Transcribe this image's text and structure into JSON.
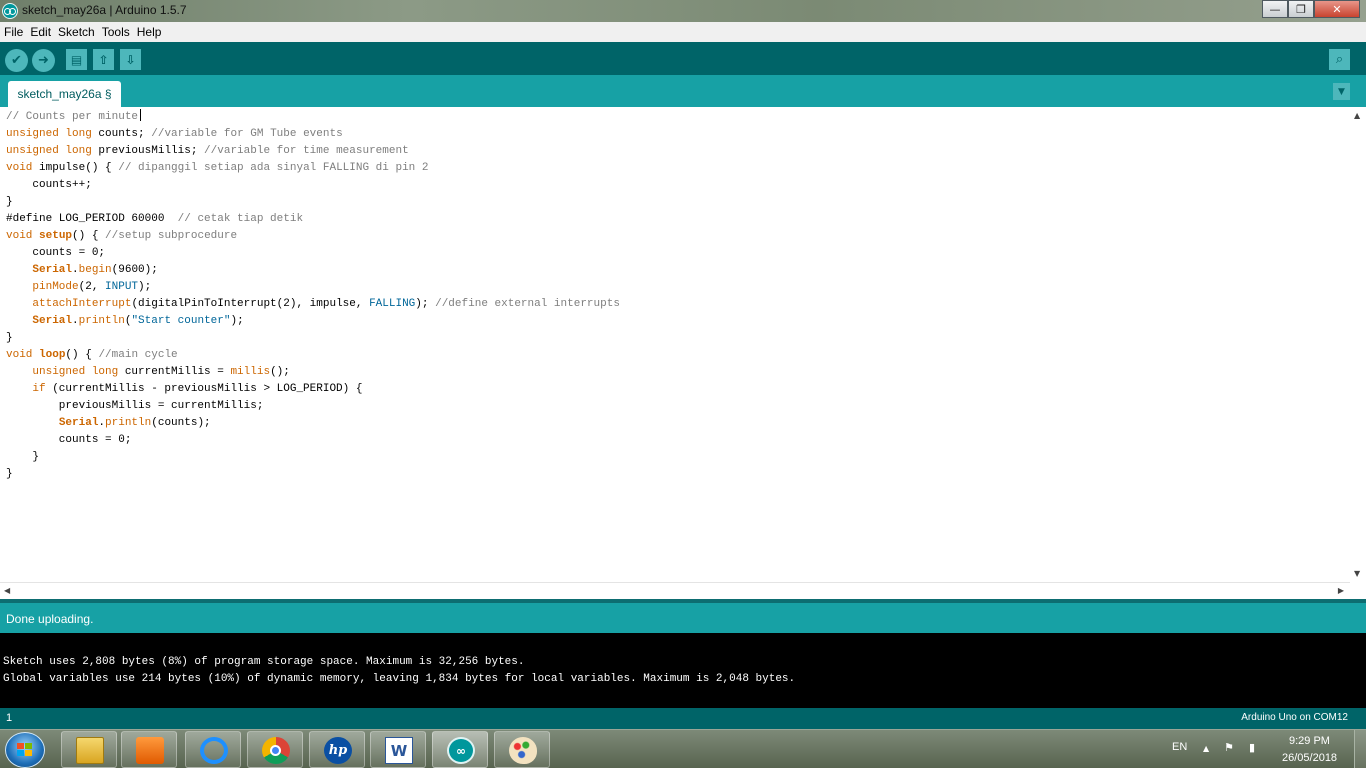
{
  "window": {
    "title": "sketch_may26a | Arduino 1.5.7",
    "minimize": "—",
    "maximize": "❐",
    "close": "✕"
  },
  "menu": [
    "File",
    "Edit",
    "Sketch",
    "Tools",
    "Help"
  ],
  "toolbar": {
    "verify_icon": "✔",
    "upload_icon": "➜",
    "new_icon": "▤",
    "open_icon": "⇧",
    "save_icon": "⇩",
    "serial_icon": "⌕"
  },
  "tab": {
    "label": "sketch_may26a §",
    "menu_icon": "▼"
  },
  "code_lines": [
    "// Counts per minute",
    "unsigned long counts; //variable for GM Tube events",
    "unsigned long previousMillis; //variable for time measurement",
    "void impulse() { // dipanggil setiap ada sinyal FALLING di pin 2",
    "    counts++;",
    "}",
    "#define LOG_PERIOD 60000  // cetak tiap detik",
    "void setup() { //setup subprocedure",
    "    counts = 0;",
    "    Serial.begin(9600);",
    "    pinMode(2, INPUT);",
    "    attachInterrupt(digitalPinToInterrupt(2), impulse, FALLING); //define external interrupts",
    "    Serial.println(\"Start counter\");",
    "}",
    "void loop() { //main cycle",
    "    unsigned long currentMillis = millis();",
    "    if (currentMillis - previousMillis > LOG_PERIOD) {",
    "        previousMillis = currentMillis;",
    "        Serial.println(counts);",
    "        counts = 0;",
    "    }",
    "}"
  ],
  "status": {
    "message": "Done uploading."
  },
  "console": [
    "Sketch uses 2,808 bytes (8%) of program storage space. Maximum is 32,256 bytes.",
    "Global variables use 214 bytes (10%) of dynamic memory, leaving 1,834 bytes for local variables. Maximum is 2,048 bytes."
  ],
  "bottom": {
    "line_number": "1",
    "board": "Arduino Uno on COM12"
  },
  "taskbar": {
    "apps": [
      "file-explorer",
      "media-player",
      "internet-explorer",
      "chrome",
      "hp",
      "word",
      "arduino",
      "paint"
    ],
    "language": "EN",
    "tray_up": "▲",
    "tray_flag": "⚑",
    "tray_power": "▮",
    "time": "9:29 PM",
    "date": "26/05/2018"
  },
  "colors": {
    "arduino_teal": "#00979c",
    "toolbar_dark": "#006468",
    "keyword": "#cc6600",
    "comment": "#7e7e7e",
    "constant": "#006699"
  }
}
